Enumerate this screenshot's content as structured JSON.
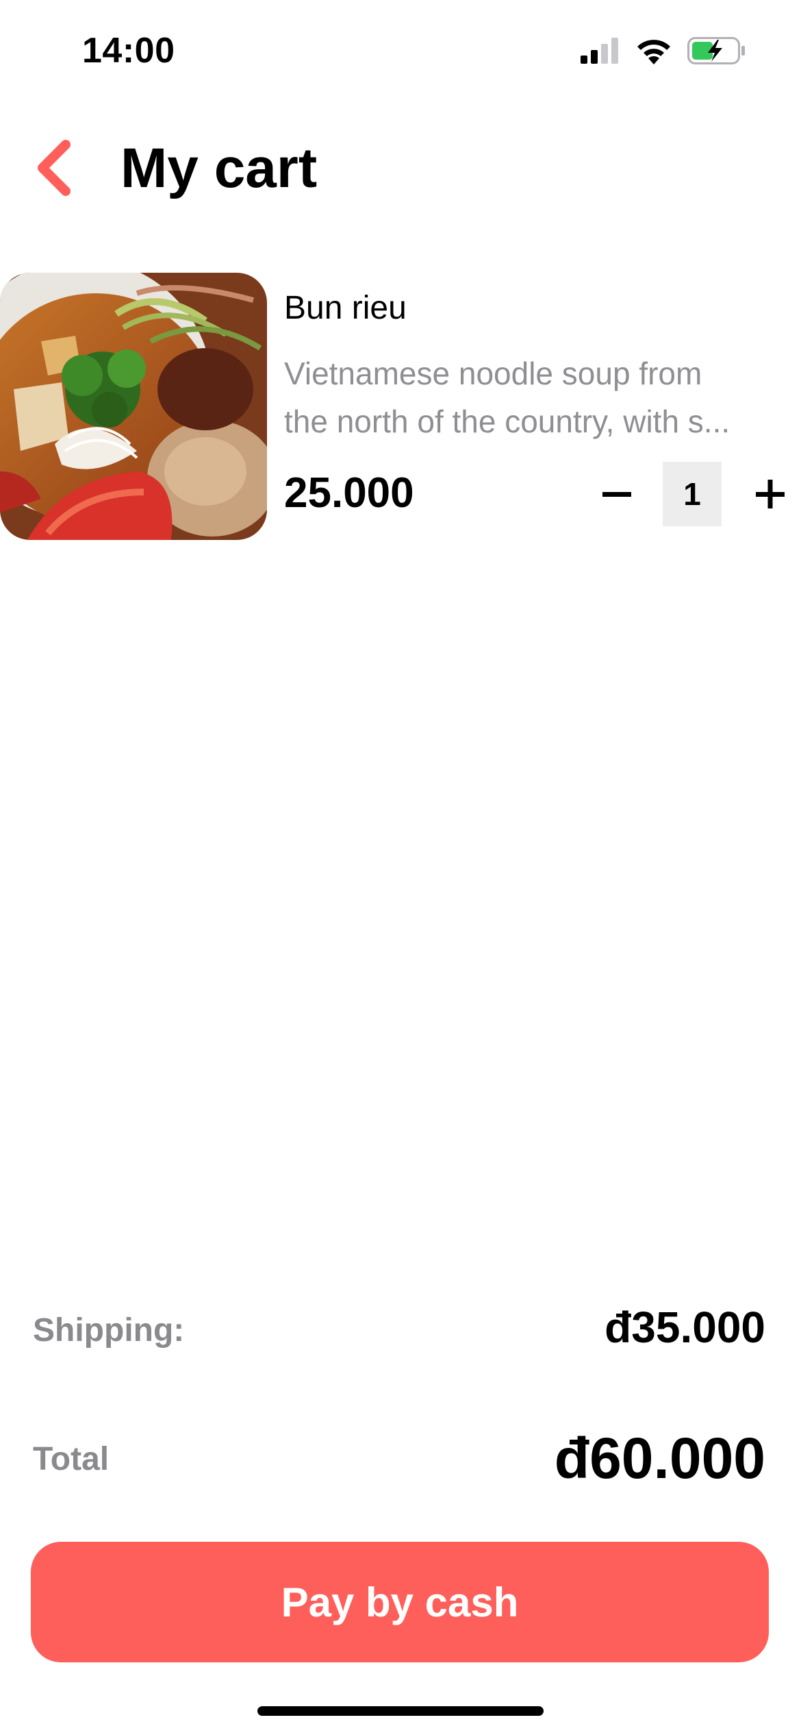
{
  "status_bar": {
    "time": "14:00",
    "icons": [
      "signal-icon",
      "wifi-icon",
      "battery-charging-icon"
    ]
  },
  "header": {
    "back_icon": "chevron-left-icon",
    "title": "My cart"
  },
  "cart": {
    "items": [
      {
        "name": "Bun rieu",
        "description_line1": "Vietnamese noodle soup from",
        "description_line2": "the north of the country, with s...",
        "price": "25.000",
        "quantity": "1",
        "decrease_label": "−",
        "increase_label": "+"
      }
    ]
  },
  "summary": {
    "shipping_label": "Shipping:",
    "shipping_value": "đ35.000",
    "total_label": "Total",
    "total_value": "đ60.000"
  },
  "actions": {
    "pay_label": "Pay by cash"
  },
  "colors": {
    "accent": "#FF5F5A",
    "muted_text": "#8E8E93",
    "quantity_bg": "#EDEDED"
  }
}
